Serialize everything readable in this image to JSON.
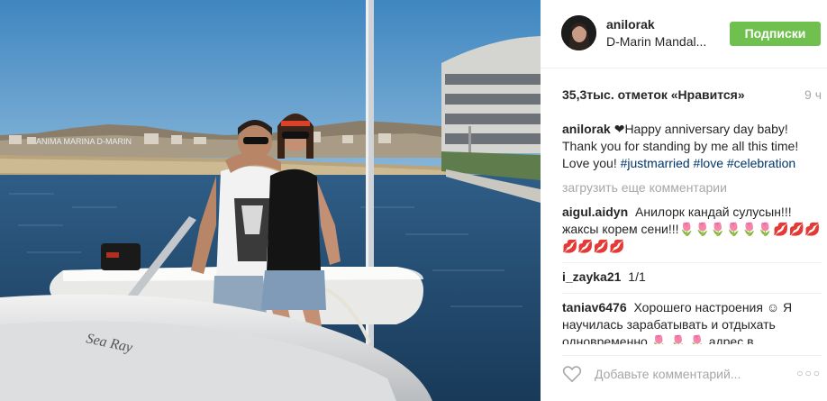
{
  "header": {
    "username": "anilorak",
    "location": "D-Marin Mandal...",
    "follow_label": "Подписки"
  },
  "meta": {
    "likes": "35,3тыс. отметок «Нравится»",
    "time": "9 ч"
  },
  "caption": {
    "user": "anilorak",
    "heart": "❤",
    "text": "Happy anniversary day baby! Thank you for standing by me all this time! Love you!",
    "hashtags": [
      "#justmarried",
      "#love",
      "#celebration"
    ]
  },
  "load_more": "загрузить еще комментарии",
  "comments": [
    {
      "user": "aigul.aidyn",
      "text": "Анилорк кандай сулусын!!! жаксы корем сени!!!🌷🌷🌷🌷🌷🌷💋💋💋💋💋💋💋"
    },
    {
      "user": "i_zayka21",
      "text": "1/1"
    },
    {
      "user": "taniav6476",
      "text": "Хорошего настроения ☺ Я научилась зарабатывать и отдыхать одновременно 🌷 🌷 🌷 адрес в"
    }
  ],
  "footer": {
    "comment_placeholder": "Добавьте комментарий...",
    "more_options": "○○○"
  },
  "photo": {
    "boat_brand": "Sea Ray",
    "far_sign": "ANIMA MARINA D-MARIN"
  },
  "colors": {
    "follow_button": "#70c050",
    "hashtag": "#003569",
    "muted": "#a5a7aa"
  }
}
